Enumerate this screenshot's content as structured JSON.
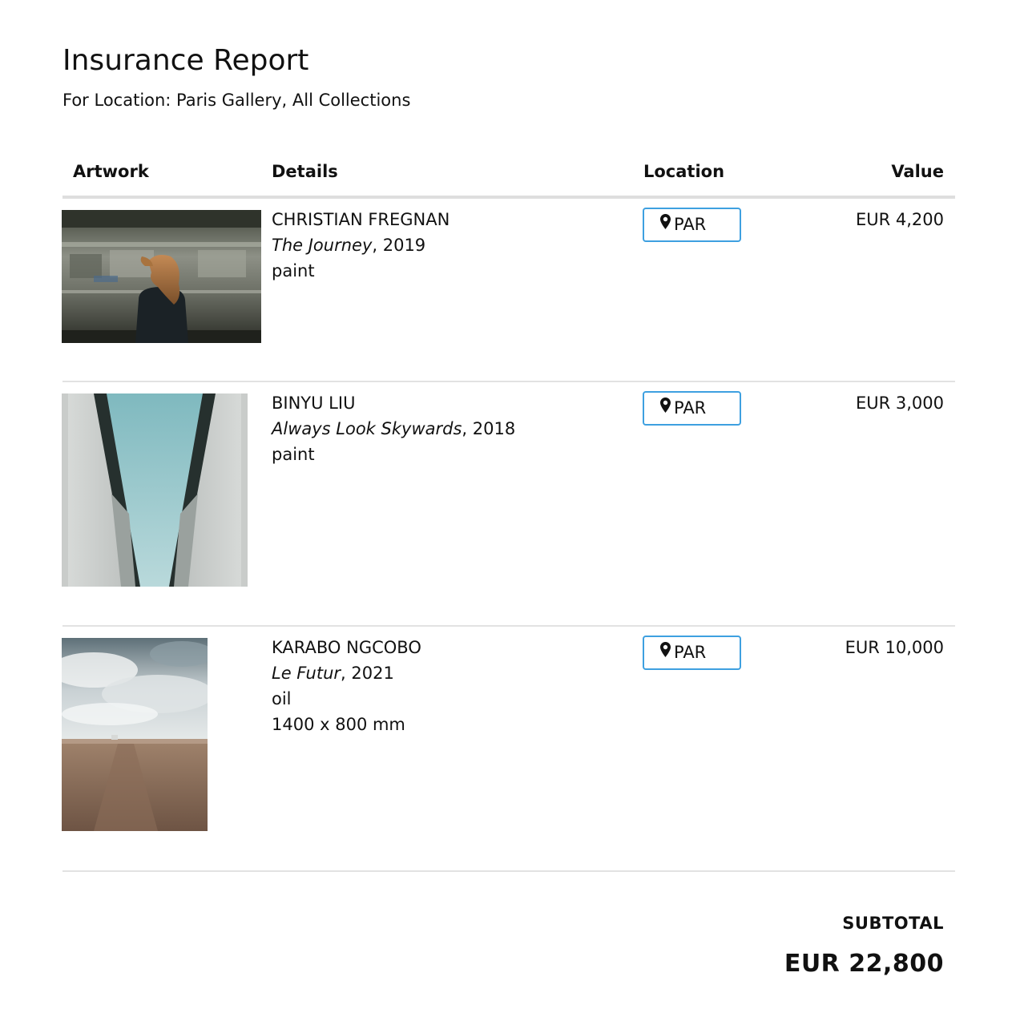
{
  "report": {
    "title": "Insurance Report",
    "subtitle": "For Location: Paris Gallery, All Collections"
  },
  "table": {
    "headers": {
      "artwork": "Artwork",
      "details": "Details",
      "location": "Location",
      "value": "Value"
    },
    "rows": [
      {
        "artist": "CHRISTIAN FREGNAN",
        "title": "The Journey",
        "year": ", 2019",
        "medium": "paint",
        "dimensions": "",
        "location": "PAR",
        "value": "EUR 4,200"
      },
      {
        "artist": "BINYU LIU",
        "title": "Always Look Skywards",
        "year": ", 2018",
        "medium": "paint",
        "dimensions": "",
        "location": "PAR",
        "value": "EUR 3,000"
      },
      {
        "artist": "KARABO NGCOBO",
        "title": "Le Futur",
        "year": ", 2021",
        "medium": "oil",
        "dimensions": "1400 x 800 mm",
        "location": "PAR",
        "value": "EUR 10,000"
      }
    ]
  },
  "summary": {
    "subtotal_label": "SUBTOTAL",
    "subtotal_value": "EUR 22,800"
  },
  "icons": {
    "location": "map-marker-icon"
  },
  "colors": {
    "location_border": "#3ea0e0"
  }
}
